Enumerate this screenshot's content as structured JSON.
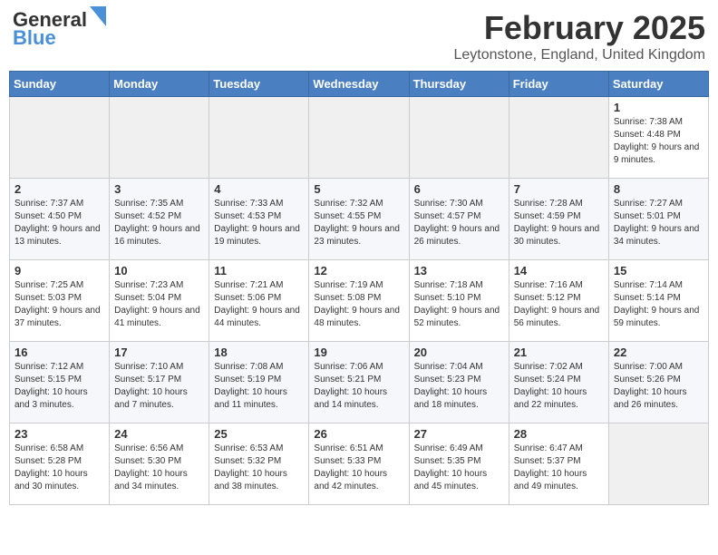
{
  "header": {
    "logo_line1": "General",
    "logo_line2": "Blue",
    "title": "February 2025",
    "subtitle": "Leytonstone, England, United Kingdom"
  },
  "weekdays": [
    "Sunday",
    "Monday",
    "Tuesday",
    "Wednesday",
    "Thursday",
    "Friday",
    "Saturday"
  ],
  "weeks": [
    [
      {
        "day": "",
        "info": ""
      },
      {
        "day": "",
        "info": ""
      },
      {
        "day": "",
        "info": ""
      },
      {
        "day": "",
        "info": ""
      },
      {
        "day": "",
        "info": ""
      },
      {
        "day": "",
        "info": ""
      },
      {
        "day": "1",
        "info": "Sunrise: 7:38 AM\nSunset: 4:48 PM\nDaylight: 9 hours and 9 minutes."
      }
    ],
    [
      {
        "day": "2",
        "info": "Sunrise: 7:37 AM\nSunset: 4:50 PM\nDaylight: 9 hours and 13 minutes."
      },
      {
        "day": "3",
        "info": "Sunrise: 7:35 AM\nSunset: 4:52 PM\nDaylight: 9 hours and 16 minutes."
      },
      {
        "day": "4",
        "info": "Sunrise: 7:33 AM\nSunset: 4:53 PM\nDaylight: 9 hours and 19 minutes."
      },
      {
        "day": "5",
        "info": "Sunrise: 7:32 AM\nSunset: 4:55 PM\nDaylight: 9 hours and 23 minutes."
      },
      {
        "day": "6",
        "info": "Sunrise: 7:30 AM\nSunset: 4:57 PM\nDaylight: 9 hours and 26 minutes."
      },
      {
        "day": "7",
        "info": "Sunrise: 7:28 AM\nSunset: 4:59 PM\nDaylight: 9 hours and 30 minutes."
      },
      {
        "day": "8",
        "info": "Sunrise: 7:27 AM\nSunset: 5:01 PM\nDaylight: 9 hours and 34 minutes."
      }
    ],
    [
      {
        "day": "9",
        "info": "Sunrise: 7:25 AM\nSunset: 5:03 PM\nDaylight: 9 hours and 37 minutes."
      },
      {
        "day": "10",
        "info": "Sunrise: 7:23 AM\nSunset: 5:04 PM\nDaylight: 9 hours and 41 minutes."
      },
      {
        "day": "11",
        "info": "Sunrise: 7:21 AM\nSunset: 5:06 PM\nDaylight: 9 hours and 44 minutes."
      },
      {
        "day": "12",
        "info": "Sunrise: 7:19 AM\nSunset: 5:08 PM\nDaylight: 9 hours and 48 minutes."
      },
      {
        "day": "13",
        "info": "Sunrise: 7:18 AM\nSunset: 5:10 PM\nDaylight: 9 hours and 52 minutes."
      },
      {
        "day": "14",
        "info": "Sunrise: 7:16 AM\nSunset: 5:12 PM\nDaylight: 9 hours and 56 minutes."
      },
      {
        "day": "15",
        "info": "Sunrise: 7:14 AM\nSunset: 5:14 PM\nDaylight: 9 hours and 59 minutes."
      }
    ],
    [
      {
        "day": "16",
        "info": "Sunrise: 7:12 AM\nSunset: 5:15 PM\nDaylight: 10 hours and 3 minutes."
      },
      {
        "day": "17",
        "info": "Sunrise: 7:10 AM\nSunset: 5:17 PM\nDaylight: 10 hours and 7 minutes."
      },
      {
        "day": "18",
        "info": "Sunrise: 7:08 AM\nSunset: 5:19 PM\nDaylight: 10 hours and 11 minutes."
      },
      {
        "day": "19",
        "info": "Sunrise: 7:06 AM\nSunset: 5:21 PM\nDaylight: 10 hours and 14 minutes."
      },
      {
        "day": "20",
        "info": "Sunrise: 7:04 AM\nSunset: 5:23 PM\nDaylight: 10 hours and 18 minutes."
      },
      {
        "day": "21",
        "info": "Sunrise: 7:02 AM\nSunset: 5:24 PM\nDaylight: 10 hours and 22 minutes."
      },
      {
        "day": "22",
        "info": "Sunrise: 7:00 AM\nSunset: 5:26 PM\nDaylight: 10 hours and 26 minutes."
      }
    ],
    [
      {
        "day": "23",
        "info": "Sunrise: 6:58 AM\nSunset: 5:28 PM\nDaylight: 10 hours and 30 minutes."
      },
      {
        "day": "24",
        "info": "Sunrise: 6:56 AM\nSunset: 5:30 PM\nDaylight: 10 hours and 34 minutes."
      },
      {
        "day": "25",
        "info": "Sunrise: 6:53 AM\nSunset: 5:32 PM\nDaylight: 10 hours and 38 minutes."
      },
      {
        "day": "26",
        "info": "Sunrise: 6:51 AM\nSunset: 5:33 PM\nDaylight: 10 hours and 42 minutes."
      },
      {
        "day": "27",
        "info": "Sunrise: 6:49 AM\nSunset: 5:35 PM\nDaylight: 10 hours and 45 minutes."
      },
      {
        "day": "28",
        "info": "Sunrise: 6:47 AM\nSunset: 5:37 PM\nDaylight: 10 hours and 49 minutes."
      },
      {
        "day": "",
        "info": ""
      }
    ]
  ]
}
